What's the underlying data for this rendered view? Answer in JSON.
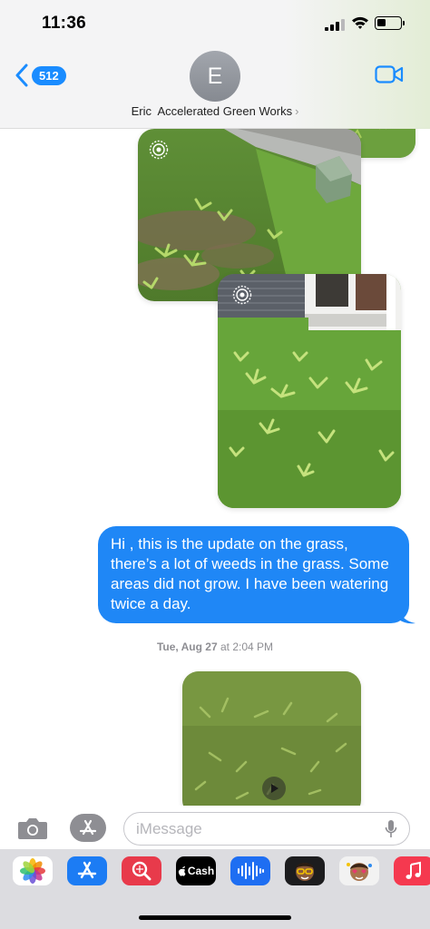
{
  "status_bar": {
    "time": "11:36",
    "battery_level_percent": 40
  },
  "header": {
    "back_badge": "512",
    "avatar_initial": "E",
    "contact_name": "Eric  Accelerated Green Works",
    "contact_chevron": "›"
  },
  "messages": [
    {
      "type": "image",
      "sender": "contact",
      "label": "Lawn photo with weeds (Live Photo)",
      "live_icon": "live-photo-icon"
    },
    {
      "type": "image",
      "sender": "contact",
      "label": "Front lawn photo with weeds near house (Live Photo)",
      "live_icon": "live-photo-icon"
    },
    {
      "type": "text",
      "sender": "me",
      "text": "Hi , this is the update on the grass, there’s a lot of weeds in the grass. Some areas did not grow. I have been watering twice a day."
    },
    {
      "type": "timestamp",
      "day": "Tue, Aug 27",
      "time": " at 2:04 PM"
    },
    {
      "type": "video",
      "sender": "contact",
      "label": "Grass close-up video",
      "play_icon": "play-icon"
    }
  ],
  "input_bar": {
    "placeholder": "iMessage",
    "camera_icon": "camera-icon",
    "apps_icon": "app-store-icon",
    "mic_icon": "microphone-icon"
  },
  "app_drawer": {
    "apps": [
      {
        "name": "Photos",
        "icon": "photos-icon"
      },
      {
        "name": "App Store",
        "icon": "app-store-icon"
      },
      {
        "name": "Search Images",
        "icon": "image-search-icon"
      },
      {
        "name": "Apple Cash",
        "label": "Cash",
        "icon": "apple-cash-icon"
      },
      {
        "name": "Audio Message",
        "icon": "audio-waveform-icon"
      },
      {
        "name": "Memoji Stickers",
        "icon": "memoji-icon"
      },
      {
        "name": "Animoji",
        "icon": "animoji-icon"
      },
      {
        "name": "Music",
        "icon": "music-icon"
      }
    ]
  },
  "colors": {
    "accent_blue": "#1f87f6",
    "badge_blue": "#1a8cff",
    "header_bg": "#f4f4f5",
    "drawer_bg": "#dcdce0"
  }
}
